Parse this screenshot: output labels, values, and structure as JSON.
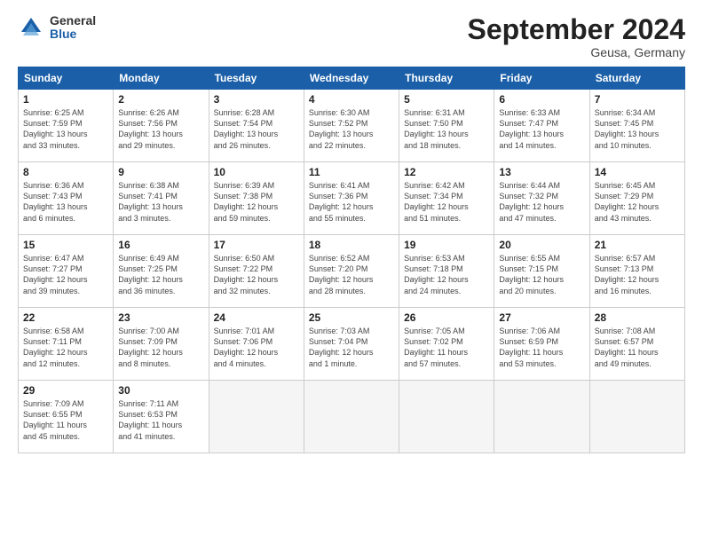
{
  "header": {
    "logo_general": "General",
    "logo_blue": "Blue",
    "title": "September 2024",
    "subtitle": "Geusa, Germany"
  },
  "weekdays": [
    "Sunday",
    "Monday",
    "Tuesday",
    "Wednesday",
    "Thursday",
    "Friday",
    "Saturday"
  ],
  "weeks": [
    [
      {
        "day": "1",
        "info": "Sunrise: 6:25 AM\nSunset: 7:59 PM\nDaylight: 13 hours\nand 33 minutes."
      },
      {
        "day": "2",
        "info": "Sunrise: 6:26 AM\nSunset: 7:56 PM\nDaylight: 13 hours\nand 29 minutes."
      },
      {
        "day": "3",
        "info": "Sunrise: 6:28 AM\nSunset: 7:54 PM\nDaylight: 13 hours\nand 26 minutes."
      },
      {
        "day": "4",
        "info": "Sunrise: 6:30 AM\nSunset: 7:52 PM\nDaylight: 13 hours\nand 22 minutes."
      },
      {
        "day": "5",
        "info": "Sunrise: 6:31 AM\nSunset: 7:50 PM\nDaylight: 13 hours\nand 18 minutes."
      },
      {
        "day": "6",
        "info": "Sunrise: 6:33 AM\nSunset: 7:47 PM\nDaylight: 13 hours\nand 14 minutes."
      },
      {
        "day": "7",
        "info": "Sunrise: 6:34 AM\nSunset: 7:45 PM\nDaylight: 13 hours\nand 10 minutes."
      }
    ],
    [
      {
        "day": "8",
        "info": "Sunrise: 6:36 AM\nSunset: 7:43 PM\nDaylight: 13 hours\nand 6 minutes."
      },
      {
        "day": "9",
        "info": "Sunrise: 6:38 AM\nSunset: 7:41 PM\nDaylight: 13 hours\nand 3 minutes."
      },
      {
        "day": "10",
        "info": "Sunrise: 6:39 AM\nSunset: 7:38 PM\nDaylight: 12 hours\nand 59 minutes."
      },
      {
        "day": "11",
        "info": "Sunrise: 6:41 AM\nSunset: 7:36 PM\nDaylight: 12 hours\nand 55 minutes."
      },
      {
        "day": "12",
        "info": "Sunrise: 6:42 AM\nSunset: 7:34 PM\nDaylight: 12 hours\nand 51 minutes."
      },
      {
        "day": "13",
        "info": "Sunrise: 6:44 AM\nSunset: 7:32 PM\nDaylight: 12 hours\nand 47 minutes."
      },
      {
        "day": "14",
        "info": "Sunrise: 6:45 AM\nSunset: 7:29 PM\nDaylight: 12 hours\nand 43 minutes."
      }
    ],
    [
      {
        "day": "15",
        "info": "Sunrise: 6:47 AM\nSunset: 7:27 PM\nDaylight: 12 hours\nand 39 minutes."
      },
      {
        "day": "16",
        "info": "Sunrise: 6:49 AM\nSunset: 7:25 PM\nDaylight: 12 hours\nand 36 minutes."
      },
      {
        "day": "17",
        "info": "Sunrise: 6:50 AM\nSunset: 7:22 PM\nDaylight: 12 hours\nand 32 minutes."
      },
      {
        "day": "18",
        "info": "Sunrise: 6:52 AM\nSunset: 7:20 PM\nDaylight: 12 hours\nand 28 minutes."
      },
      {
        "day": "19",
        "info": "Sunrise: 6:53 AM\nSunset: 7:18 PM\nDaylight: 12 hours\nand 24 minutes."
      },
      {
        "day": "20",
        "info": "Sunrise: 6:55 AM\nSunset: 7:15 PM\nDaylight: 12 hours\nand 20 minutes."
      },
      {
        "day": "21",
        "info": "Sunrise: 6:57 AM\nSunset: 7:13 PM\nDaylight: 12 hours\nand 16 minutes."
      }
    ],
    [
      {
        "day": "22",
        "info": "Sunrise: 6:58 AM\nSunset: 7:11 PM\nDaylight: 12 hours\nand 12 minutes."
      },
      {
        "day": "23",
        "info": "Sunrise: 7:00 AM\nSunset: 7:09 PM\nDaylight: 12 hours\nand 8 minutes."
      },
      {
        "day": "24",
        "info": "Sunrise: 7:01 AM\nSunset: 7:06 PM\nDaylight: 12 hours\nand 4 minutes."
      },
      {
        "day": "25",
        "info": "Sunrise: 7:03 AM\nSunset: 7:04 PM\nDaylight: 12 hours\nand 1 minute."
      },
      {
        "day": "26",
        "info": "Sunrise: 7:05 AM\nSunset: 7:02 PM\nDaylight: 11 hours\nand 57 minutes."
      },
      {
        "day": "27",
        "info": "Sunrise: 7:06 AM\nSunset: 6:59 PM\nDaylight: 11 hours\nand 53 minutes."
      },
      {
        "day": "28",
        "info": "Sunrise: 7:08 AM\nSunset: 6:57 PM\nDaylight: 11 hours\nand 49 minutes."
      }
    ],
    [
      {
        "day": "29",
        "info": "Sunrise: 7:09 AM\nSunset: 6:55 PM\nDaylight: 11 hours\nand 45 minutes."
      },
      {
        "day": "30",
        "info": "Sunrise: 7:11 AM\nSunset: 6:53 PM\nDaylight: 11 hours\nand 41 minutes."
      },
      {
        "day": "",
        "info": ""
      },
      {
        "day": "",
        "info": ""
      },
      {
        "day": "",
        "info": ""
      },
      {
        "day": "",
        "info": ""
      },
      {
        "day": "",
        "info": ""
      }
    ]
  ]
}
